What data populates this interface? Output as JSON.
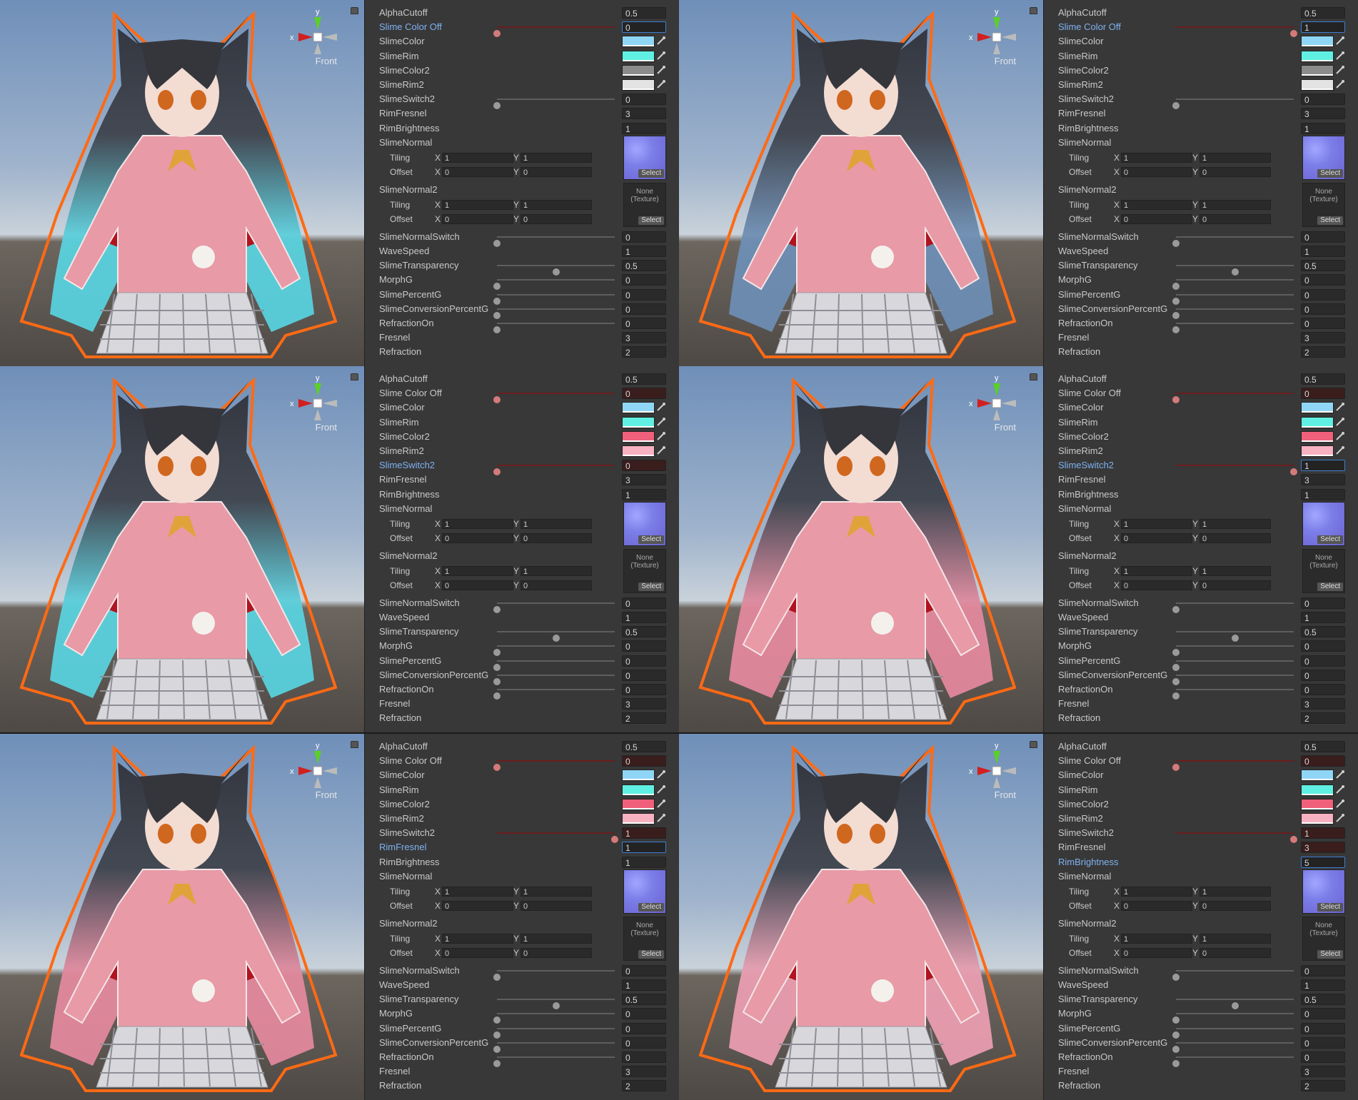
{
  "scene_view": {
    "view_label": "Front",
    "axis_label": "x",
    "axis_label_y": "y"
  },
  "tex_labels": {
    "none_line1": "None",
    "none_line2": "(Texture)",
    "select": "Select"
  },
  "tiling_labels": {
    "tiling": "Tiling",
    "offset": "Offset",
    "x": "X",
    "y": "Y"
  },
  "panels": [
    {
      "hair_color": "#58d7e4",
      "props": [
        {
          "label": "AlphaCutoff",
          "type": "value",
          "value": "0.5"
        },
        {
          "label": "Slime Color Off",
          "type": "slider",
          "value": "0",
          "pos": 0,
          "red": true,
          "active": true,
          "focus": true
        },
        {
          "label": "SlimeColor",
          "type": "color",
          "color": "#8fd6f6"
        },
        {
          "label": "SlimeRim",
          "type": "color",
          "color": "#5ff0e3"
        },
        {
          "label": "SlimeColor2",
          "type": "color",
          "color": "#8b8b8b"
        },
        {
          "label": "SlimeRim2",
          "type": "color",
          "color": "#e3e3e3"
        },
        {
          "label": "SlimeSwitch2",
          "type": "slider",
          "value": "0",
          "pos": 0
        },
        {
          "label": "RimFresnel",
          "type": "value",
          "value": "3"
        },
        {
          "label": "RimBrightness",
          "type": "value",
          "value": "1"
        },
        {
          "label": "SlimeNormal",
          "type": "texture",
          "tex": "normal",
          "tiling": [
            "1",
            "1"
          ],
          "offset": [
            "0",
            "0"
          ]
        },
        {
          "label": "SlimeNormal2",
          "type": "texture",
          "tex": "none",
          "tiling": [
            "1",
            "1"
          ],
          "offset": [
            "0",
            "0"
          ]
        },
        {
          "label": "SlimeNormalSwitch",
          "type": "slider",
          "value": "0",
          "pos": 0
        },
        {
          "label": "WaveSpeed",
          "type": "value",
          "value": "1"
        },
        {
          "label": "SlimeTransparency",
          "type": "slider",
          "value": "0.5",
          "pos": 0.5
        },
        {
          "label": "MorphG",
          "type": "slider",
          "value": "0",
          "pos": 0
        },
        {
          "label": "SlimePercentG",
          "type": "slider",
          "value": "0",
          "pos": 0
        },
        {
          "label": "SlimeConversionPercentG",
          "type": "slider",
          "value": "0",
          "pos": 0
        },
        {
          "label": "RefractionOn",
          "type": "slider",
          "value": "0",
          "pos": 0
        },
        {
          "label": "Fresnel",
          "type": "value",
          "value": "3"
        },
        {
          "label": "Refraction",
          "type": "value",
          "value": "2"
        }
      ]
    },
    {
      "hair_color": "#6d90b8",
      "props": [
        {
          "label": "AlphaCutoff",
          "type": "value",
          "value": "0.5"
        },
        {
          "label": "Slime Color Off",
          "type": "slider",
          "value": "1",
          "pos": 1,
          "red": true,
          "active": true,
          "focus": true
        },
        {
          "label": "SlimeColor",
          "type": "color",
          "color": "#8fd6f6"
        },
        {
          "label": "SlimeRim",
          "type": "color",
          "color": "#5ff0e3"
        },
        {
          "label": "SlimeColor2",
          "type": "color",
          "color": "#8b8b8b"
        },
        {
          "label": "SlimeRim2",
          "type": "color",
          "color": "#e3e3e3"
        },
        {
          "label": "SlimeSwitch2",
          "type": "slider",
          "value": "0",
          "pos": 0
        },
        {
          "label": "RimFresnel",
          "type": "value",
          "value": "3"
        },
        {
          "label": "RimBrightness",
          "type": "value",
          "value": "1"
        },
        {
          "label": "SlimeNormal",
          "type": "texture",
          "tex": "normal",
          "tiling": [
            "1",
            "1"
          ],
          "offset": [
            "0",
            "0"
          ]
        },
        {
          "label": "SlimeNormal2",
          "type": "texture",
          "tex": "none",
          "tiling": [
            "1",
            "1"
          ],
          "offset": [
            "0",
            "0"
          ]
        },
        {
          "label": "SlimeNormalSwitch",
          "type": "slider",
          "value": "0",
          "pos": 0
        },
        {
          "label": "WaveSpeed",
          "type": "value",
          "value": "1"
        },
        {
          "label": "SlimeTransparency",
          "type": "slider",
          "value": "0.5",
          "pos": 0.5
        },
        {
          "label": "MorphG",
          "type": "slider",
          "value": "0",
          "pos": 0
        },
        {
          "label": "SlimePercentG",
          "type": "slider",
          "value": "0",
          "pos": 0
        },
        {
          "label": "SlimeConversionPercentG",
          "type": "slider",
          "value": "0",
          "pos": 0
        },
        {
          "label": "RefractionOn",
          "type": "slider",
          "value": "0",
          "pos": 0
        },
        {
          "label": "Fresnel",
          "type": "value",
          "value": "3"
        },
        {
          "label": "Refraction",
          "type": "value",
          "value": "2"
        }
      ]
    },
    {
      "hair_color": "#58d7e4",
      "props": [
        {
          "label": "AlphaCutoff",
          "type": "value",
          "value": "0.5"
        },
        {
          "label": "Slime Color Off",
          "type": "slider",
          "value": "0",
          "pos": 0,
          "red": true
        },
        {
          "label": "SlimeColor",
          "type": "color",
          "color": "#8fd6f6"
        },
        {
          "label": "SlimeRim",
          "type": "color",
          "color": "#5ff0e3"
        },
        {
          "label": "SlimeColor2",
          "type": "color",
          "color": "#f0607a"
        },
        {
          "label": "SlimeRim2",
          "type": "color",
          "color": "#f7b1c0"
        },
        {
          "label": "SlimeSwitch2",
          "type": "slider",
          "value": "0",
          "pos": 0,
          "red": true,
          "active": true
        },
        {
          "label": "RimFresnel",
          "type": "value",
          "value": "3"
        },
        {
          "label": "RimBrightness",
          "type": "value",
          "value": "1"
        },
        {
          "label": "SlimeNormal",
          "type": "texture",
          "tex": "normal",
          "tiling": [
            "1",
            "1"
          ],
          "offset": [
            "0",
            "0"
          ]
        },
        {
          "label": "SlimeNormal2",
          "type": "texture",
          "tex": "none",
          "tiling": [
            "1",
            "1"
          ],
          "offset": [
            "0",
            "0"
          ]
        },
        {
          "label": "SlimeNormalSwitch",
          "type": "slider",
          "value": "0",
          "pos": 0
        },
        {
          "label": "WaveSpeed",
          "type": "value",
          "value": "1"
        },
        {
          "label": "SlimeTransparency",
          "type": "slider",
          "value": "0.5",
          "pos": 0.5
        },
        {
          "label": "MorphG",
          "type": "slider",
          "value": "0",
          "pos": 0
        },
        {
          "label": "SlimePercentG",
          "type": "slider",
          "value": "0",
          "pos": 0
        },
        {
          "label": "SlimeConversionPercentG",
          "type": "slider",
          "value": "0",
          "pos": 0
        },
        {
          "label": "RefractionOn",
          "type": "slider",
          "value": "0",
          "pos": 0
        },
        {
          "label": "Fresnel",
          "type": "value",
          "value": "3"
        },
        {
          "label": "Refraction",
          "type": "value",
          "value": "2"
        }
      ]
    },
    {
      "hair_color": "#e98aa0",
      "props": [
        {
          "label": "AlphaCutoff",
          "type": "value",
          "value": "0.5"
        },
        {
          "label": "Slime Color Off",
          "type": "slider",
          "value": "0",
          "pos": 0,
          "red": true
        },
        {
          "label": "SlimeColor",
          "type": "color",
          "color": "#8fd6f6"
        },
        {
          "label": "SlimeRim",
          "type": "color",
          "color": "#5ff0e3"
        },
        {
          "label": "SlimeColor2",
          "type": "color",
          "color": "#f0607a"
        },
        {
          "label": "SlimeRim2",
          "type": "color",
          "color": "#f7b1c0"
        },
        {
          "label": "SlimeSwitch2",
          "type": "slider",
          "value": "1",
          "pos": 1,
          "red": true,
          "active": true,
          "focus": true
        },
        {
          "label": "RimFresnel",
          "type": "value",
          "value": "3"
        },
        {
          "label": "RimBrightness",
          "type": "value",
          "value": "1"
        },
        {
          "label": "SlimeNormal",
          "type": "texture",
          "tex": "normal",
          "tiling": [
            "1",
            "1"
          ],
          "offset": [
            "0",
            "0"
          ]
        },
        {
          "label": "SlimeNormal2",
          "type": "texture",
          "tex": "none",
          "tiling": [
            "1",
            "1"
          ],
          "offset": [
            "0",
            "0"
          ]
        },
        {
          "label": "SlimeNormalSwitch",
          "type": "slider",
          "value": "0",
          "pos": 0
        },
        {
          "label": "WaveSpeed",
          "type": "value",
          "value": "1"
        },
        {
          "label": "SlimeTransparency",
          "type": "slider",
          "value": "0.5",
          "pos": 0.5
        },
        {
          "label": "MorphG",
          "type": "slider",
          "value": "0",
          "pos": 0
        },
        {
          "label": "SlimePercentG",
          "type": "slider",
          "value": "0",
          "pos": 0
        },
        {
          "label": "SlimeConversionPercentG",
          "type": "slider",
          "value": "0",
          "pos": 0
        },
        {
          "label": "RefractionOn",
          "type": "slider",
          "value": "0",
          "pos": 0
        },
        {
          "label": "Fresnel",
          "type": "value",
          "value": "3"
        },
        {
          "label": "Refraction",
          "type": "value",
          "value": "2"
        }
      ]
    },
    {
      "hair_color": "#e98aa0",
      "props": [
        {
          "label": "AlphaCutoff",
          "type": "value",
          "value": "0.5"
        },
        {
          "label": "Slime Color Off",
          "type": "slider",
          "value": "0",
          "pos": 0,
          "red": true
        },
        {
          "label": "SlimeColor",
          "type": "color",
          "color": "#8fd6f6"
        },
        {
          "label": "SlimeRim",
          "type": "color",
          "color": "#5ff0e3"
        },
        {
          "label": "SlimeColor2",
          "type": "color",
          "color": "#f0607a"
        },
        {
          "label": "SlimeRim2",
          "type": "color",
          "color": "#f7b1c0"
        },
        {
          "label": "SlimeSwitch2",
          "type": "slider",
          "value": "1",
          "pos": 1,
          "red": true
        },
        {
          "label": "RimFresnel",
          "type": "value",
          "value": "1",
          "active": true,
          "focus": true
        },
        {
          "label": "RimBrightness",
          "type": "value",
          "value": "1"
        },
        {
          "label": "SlimeNormal",
          "type": "texture",
          "tex": "normal",
          "tiling": [
            "1",
            "1"
          ],
          "offset": [
            "0",
            "0"
          ]
        },
        {
          "label": "SlimeNormal2",
          "type": "texture",
          "tex": "none",
          "tiling": [
            "1",
            "1"
          ],
          "offset": [
            "0",
            "0"
          ]
        },
        {
          "label": "SlimeNormalSwitch",
          "type": "slider",
          "value": "0",
          "pos": 0
        },
        {
          "label": "WaveSpeed",
          "type": "value",
          "value": "1"
        },
        {
          "label": "SlimeTransparency",
          "type": "slider",
          "value": "0.5",
          "pos": 0.5
        },
        {
          "label": "MorphG",
          "type": "slider",
          "value": "0",
          "pos": 0
        },
        {
          "label": "SlimePercentG",
          "type": "slider",
          "value": "0",
          "pos": 0
        },
        {
          "label": "SlimeConversionPercentG",
          "type": "slider",
          "value": "0",
          "pos": 0
        },
        {
          "label": "RefractionOn",
          "type": "slider",
          "value": "0",
          "pos": 0
        },
        {
          "label": "Fresnel",
          "type": "value",
          "value": "3"
        },
        {
          "label": "Refraction",
          "type": "value",
          "value": "2"
        }
      ]
    },
    {
      "hair_color": "#f0a0b4",
      "props": [
        {
          "label": "AlphaCutoff",
          "type": "value",
          "value": "0.5"
        },
        {
          "label": "Slime Color Off",
          "type": "slider",
          "value": "0",
          "pos": 0,
          "red": true
        },
        {
          "label": "SlimeColor",
          "type": "color",
          "color": "#8fd6f6"
        },
        {
          "label": "SlimeRim",
          "type": "color",
          "color": "#5ff0e3"
        },
        {
          "label": "SlimeColor2",
          "type": "color",
          "color": "#f0607a"
        },
        {
          "label": "SlimeRim2",
          "type": "color",
          "color": "#f7b1c0"
        },
        {
          "label": "SlimeSwitch2",
          "type": "slider",
          "value": "1",
          "pos": 1,
          "red": true
        },
        {
          "label": "RimFresnel",
          "type": "value",
          "value": "3",
          "redbox": true
        },
        {
          "label": "RimBrightness",
          "type": "value",
          "value": "5",
          "active": true,
          "focus": true
        },
        {
          "label": "SlimeNormal",
          "type": "texture",
          "tex": "normal",
          "tiling": [
            "1",
            "1"
          ],
          "offset": [
            "0",
            "0"
          ]
        },
        {
          "label": "SlimeNormal2",
          "type": "texture",
          "tex": "none",
          "tiling": [
            "1",
            "1"
          ],
          "offset": [
            "0",
            "0"
          ]
        },
        {
          "label": "SlimeNormalSwitch",
          "type": "slider",
          "value": "0",
          "pos": 0
        },
        {
          "label": "WaveSpeed",
          "type": "value",
          "value": "1"
        },
        {
          "label": "SlimeTransparency",
          "type": "slider",
          "value": "0.5",
          "pos": 0.5
        },
        {
          "label": "MorphG",
          "type": "slider",
          "value": "0",
          "pos": 0
        },
        {
          "label": "SlimePercentG",
          "type": "slider",
          "value": "0",
          "pos": 0
        },
        {
          "label": "SlimeConversionPercentG",
          "type": "slider",
          "value": "0",
          "pos": 0
        },
        {
          "label": "RefractionOn",
          "type": "slider",
          "value": "0",
          "pos": 0
        },
        {
          "label": "Fresnel",
          "type": "value",
          "value": "3"
        },
        {
          "label": "Refraction",
          "type": "value",
          "value": "2"
        }
      ]
    }
  ]
}
